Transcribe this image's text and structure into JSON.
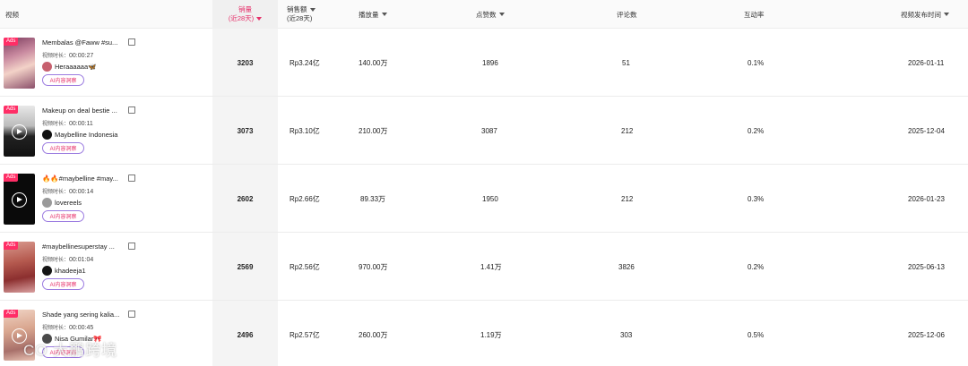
{
  "header": {
    "video": "视频",
    "sales_line1": "销量",
    "sales_line2": "(近28天)",
    "revenue_line1": "销售额",
    "revenue_line2": "(近28天)",
    "views": "播放量",
    "likes": "点赞数",
    "comments": "评论数",
    "engagement": "互动率",
    "publish_time": "视频发布时间"
  },
  "labels": {
    "ads": "Ads",
    "duration": "视频时长：",
    "ai_button": "AI内容洞察"
  },
  "rows": [
    {
      "title": "Membalas @Faww #su...",
      "duration": "00:00:27",
      "author": "Heraaaaaa🦋",
      "sales": "3203",
      "revenue": "Rp3.24亿",
      "views": "140.00万",
      "likes": "1896",
      "comments": "51",
      "engagement": "0.1%",
      "date": "2026-01-11"
    },
    {
      "title": "Makeup on deal bestie ...",
      "duration": "00:00:11",
      "author": "Maybelline Indonesia",
      "sales": "3073",
      "revenue": "Rp3.10亿",
      "views": "210.00万",
      "likes": "3087",
      "comments": "212",
      "engagement": "0.2%",
      "date": "2025-12-04"
    },
    {
      "title": "🔥🔥#maybelline #may...",
      "duration": "00:00:14",
      "author": "lovereels",
      "sales": "2602",
      "revenue": "Rp2.66亿",
      "views": "89.33万",
      "likes": "1950",
      "comments": "212",
      "engagement": "0.3%",
      "date": "2026-01-23"
    },
    {
      "title": "#maybellinesuperstay ...",
      "duration": "00:01:04",
      "author": "khadeeja1",
      "sales": "2569",
      "revenue": "Rp2.56亿",
      "views": "970.00万",
      "likes": "1.41万",
      "comments": "3826",
      "engagement": "0.2%",
      "date": "2025-06-13"
    },
    {
      "title": "Shade yang sering kalia...",
      "duration": "00:00:45",
      "author": "Nisa Gumilar🎀",
      "sales": "2496",
      "revenue": "Rp2.57亿",
      "views": "260.00万",
      "likes": "1.19万",
      "comments": "303",
      "engagement": "0.5%",
      "date": "2025-12-06"
    }
  ],
  "watermark": "CO 大鹏跨境",
  "colors": {
    "accent": "#e6306a",
    "ads_badge": "#ff2e66",
    "ai_border": "#9b7be0"
  },
  "icons": {
    "sort": "sort-desc-icon",
    "external": "external-link-icon",
    "play": "play-icon"
  }
}
